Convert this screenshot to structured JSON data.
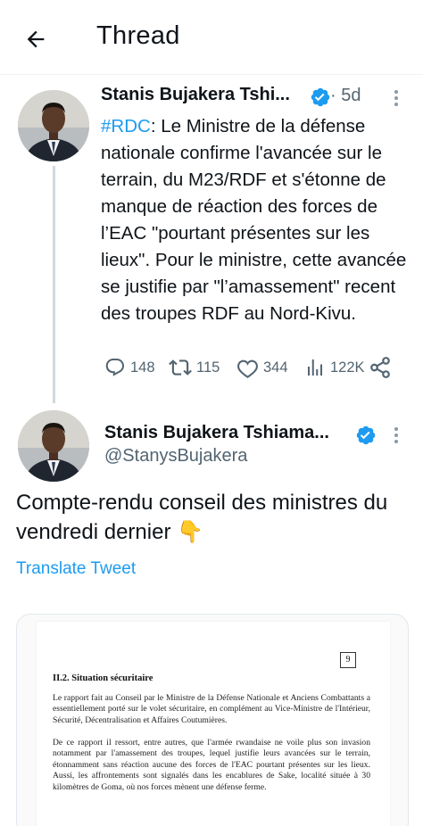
{
  "header": {
    "title": "Thread"
  },
  "tweet1": {
    "author_name": "Stanis Bujakera Tshi...",
    "time": "· 5d",
    "hashtag": "#RDC",
    "text": ": Le Ministre de la défense nationale confirme l'avancée sur le terrain, du M23/RDF et s'étonne de manque de réaction des forces de l’EAC \"pourtant présentes sur les lieux\". Pour le ministre, cette avancée se justifie par \"l’amassement\" recent des troupes RDF au Nord-Kivu.",
    "stats": {
      "replies": "148",
      "retweets": "115",
      "likes": "344",
      "views": "122K"
    }
  },
  "tweet2": {
    "author_name": "Stanis Bujakera Tshiama...",
    "handle": "@StanysBujakera",
    "text": "Compte-rendu conseil des ministres du vendredi dernier 👇",
    "translate_label": "Translate Tweet"
  },
  "document": {
    "page_number": "9",
    "heading": "II.2. Situation sécuritaire",
    "paragraph1": "Le rapport fait au Conseil par le Ministre de la Défense Nationale et Anciens Combattants a essentiellement porté sur le volet sécuritaire, en complément au Vice-Ministre de l'Intérieur, Sécurité, Décentralisation et Affaires Coutumières.",
    "paragraph2": "De ce rapport il ressort, entre autres, que l'armée rwandaise ne voile plus son invasion notamment par l'amassement des troupes, lequel justifie leurs avancées sur le terrain, étonnamment sans réaction aucune des forces de l'EAC pourtant présentes sur les lieux. Aussi, les affrontements sont signalés dans les encablures de Sake, localité située à 30 kilomètres de Goma, où nos forces mènent une défense ferme."
  },
  "colors": {
    "accent": "#1d9bf0",
    "text": "#0f1419",
    "muted": "#536471",
    "thread_line": "#cfd9de"
  },
  "icons": [
    "back-arrow-icon",
    "verified-badge-icon",
    "more-options-icon",
    "reply-icon",
    "retweet-icon",
    "like-icon",
    "views-icon",
    "share-icon"
  ]
}
